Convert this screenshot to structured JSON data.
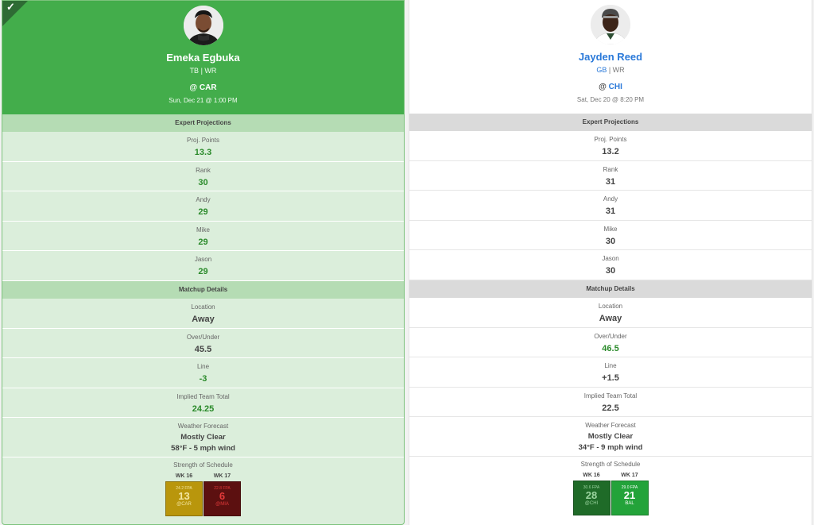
{
  "left": {
    "selected": true,
    "name": "Emeka Egbuka",
    "team": "TB",
    "position": "WR",
    "opponent": "@ CAR",
    "game_time": "Sun, Dec 21 @ 1:00 PM",
    "expert_title": "Expert Projections",
    "expert": [
      {
        "label": "Proj. Points",
        "value": "13.3"
      },
      {
        "label": "Rank",
        "value": "30"
      },
      {
        "label": "Andy",
        "value": "29"
      },
      {
        "label": "Mike",
        "value": "29"
      },
      {
        "label": "Jason",
        "value": "29"
      }
    ],
    "matchup_title": "Matchup Details",
    "matchup": [
      {
        "label": "Location",
        "value": "Away"
      },
      {
        "label": "Over/Under",
        "value": "45.5"
      },
      {
        "label": "Line",
        "value": "-3"
      },
      {
        "label": "Implied Team Total",
        "value": "24.25"
      }
    ],
    "weather": {
      "label": "Weather Forecast",
      "line1": "Mostly Clear",
      "line2": "58°F - 5 mph wind"
    },
    "sos": {
      "label": "Strength of Schedule",
      "weeks": [
        {
          "week": "WK 16",
          "fpa": "24.2 FPA",
          "rank": "13",
          "team": "@CAR",
          "bg": "#b9960c",
          "fg": "#f3e6a1"
        },
        {
          "week": "WK 17",
          "fpa": "22.8 FPA",
          "rank": "6",
          "team": "@MIA",
          "bg": "#5c1010",
          "fg": "#e33a3a"
        }
      ]
    }
  },
  "right": {
    "selected": false,
    "name": "Jayden Reed",
    "team": "GB",
    "position": "WR",
    "opponent_prefix": "@ ",
    "opponent": "CHI",
    "game_time": "Sat, Dec 20 @ 8:20 PM",
    "expert_title": "Expert Projections",
    "expert": [
      {
        "label": "Proj. Points",
        "value": "13.2"
      },
      {
        "label": "Rank",
        "value": "31"
      },
      {
        "label": "Andy",
        "value": "31"
      },
      {
        "label": "Mike",
        "value": "30"
      },
      {
        "label": "Jason",
        "value": "30"
      }
    ],
    "matchup_title": "Matchup Details",
    "matchup": [
      {
        "label": "Location",
        "value": "Away"
      },
      {
        "label": "Over/Under",
        "value": "46.5"
      },
      {
        "label": "Line",
        "value": "+1.5"
      },
      {
        "label": "Implied Team Total",
        "value": "22.5"
      }
    ],
    "weather": {
      "label": "Weather Forecast",
      "line1": "Mostly Clear",
      "line2": "34°F - 9 mph wind"
    },
    "sos": {
      "label": "Strength of Schedule",
      "weeks": [
        {
          "week": "WK 16",
          "fpa": "30.6 FPA",
          "rank": "28",
          "team": "@CHI",
          "bg": "#1f6b28",
          "fg": "#9bd49f"
        },
        {
          "week": "WK 17",
          "fpa": "29.0 FPA",
          "rank": "21",
          "team": "BAL",
          "bg": "#23a33a",
          "fg": "#ffffff"
        }
      ]
    }
  },
  "colors": {
    "winner_green": "#2a8a2a",
    "header_green": "#43ad4b",
    "name_blue": "#2a79d9"
  }
}
